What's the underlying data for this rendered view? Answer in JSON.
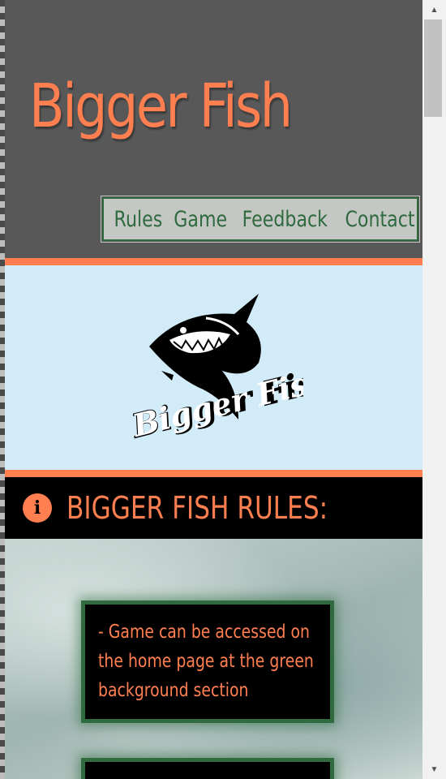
{
  "header": {
    "title": "Bigger Fish",
    "nav": [
      "Rules",
      "Game",
      "Feedback",
      "Contact"
    ]
  },
  "logo": {
    "text": "Bigger Fish"
  },
  "rules": {
    "title": "BIGGER FISH RULES:",
    "items": [
      "- Game can be accessed on the home page at the green background section",
      ""
    ]
  },
  "colors": {
    "accent": "#ff7f50",
    "green": "#2f6b3f",
    "header_bg": "#585858",
    "logo_bg": "#d1ecf8"
  },
  "icons": {
    "rules": "info-circle-icon",
    "scroll_up": "triangle-up-icon",
    "scroll_down": "triangle-down-icon"
  }
}
